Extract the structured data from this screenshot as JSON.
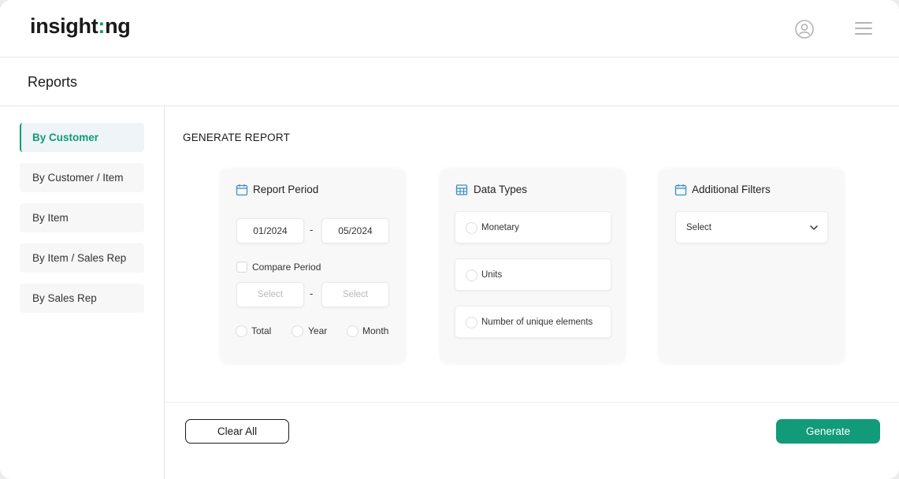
{
  "app": {
    "logo_text_1": "insight",
    "logo_text_accent": ":",
    "logo_text_2": "ng",
    "accent_color": "#119b78",
    "icons": [
      "user-icon",
      "hamburger-menu-icon"
    ]
  },
  "page": {
    "title": "Reports"
  },
  "sidebar": {
    "items": [
      {
        "label": "By Customer",
        "active": true
      },
      {
        "label": "By Customer / Item",
        "active": false
      },
      {
        "label": "By Item",
        "active": false
      },
      {
        "label": "By Item / Sales Rep",
        "active": false
      },
      {
        "label": "By Sales Rep",
        "active": false
      }
    ]
  },
  "main": {
    "section_title": "GENERATE REPORT",
    "report_period": {
      "title": "Report Period",
      "icon": "calendar-icon",
      "start": "01/2024",
      "end": "05/2024",
      "separator": "-",
      "compare_label": "Compare Period",
      "compare_start_placeholder": "Select",
      "compare_end_placeholder": "Select",
      "granularity": [
        "Total",
        "Year",
        "Month"
      ]
    },
    "data_types": {
      "title": "Data Types",
      "icon": "table-icon",
      "options": [
        "Monetary",
        "Units",
        "Number of unique elements"
      ]
    },
    "additional_filters": {
      "title": "Additional Filters",
      "icon": "calendar-icon",
      "select_value": "Select"
    }
  },
  "footer": {
    "clear_label": "Clear All",
    "generate_label": "Generate"
  }
}
